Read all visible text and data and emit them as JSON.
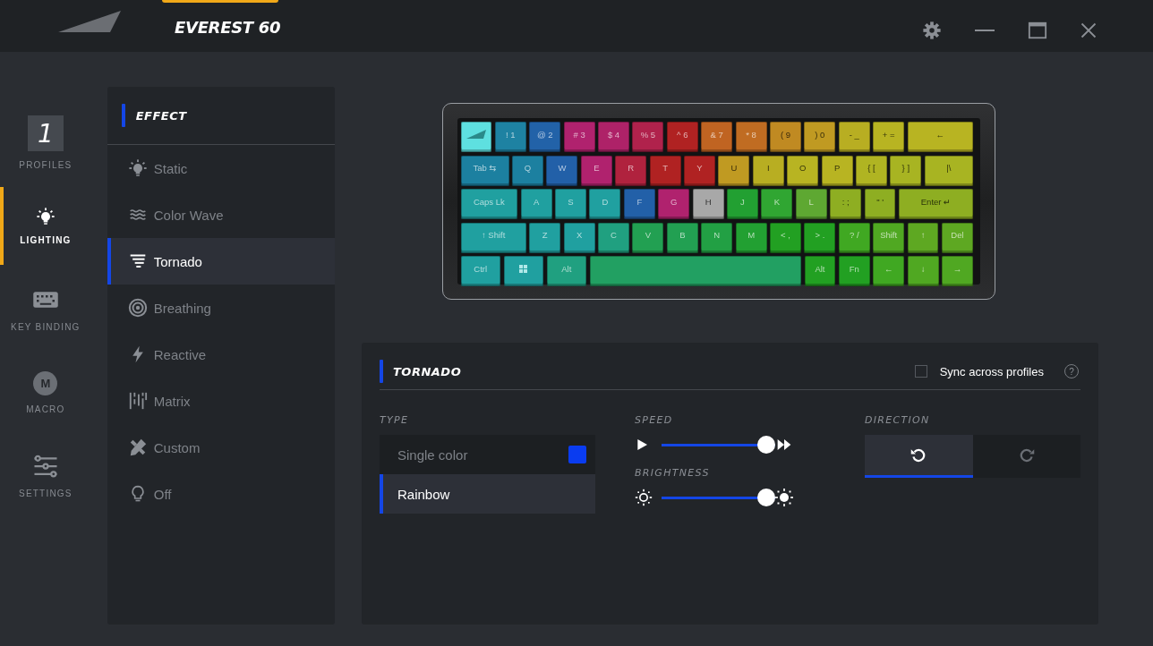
{
  "window": {
    "title": "EVEREST 60",
    "controls": [
      {
        "kind": "settings"
      },
      {
        "kind": "minimize"
      },
      {
        "kind": "maximize"
      },
      {
        "kind": "close"
      }
    ]
  },
  "nav": [
    {
      "kind": "profile",
      "badge": "1",
      "label": "PROFILES",
      "selected": false
    },
    {
      "kind": "lighting",
      "label": "LIGHTING",
      "selected": true
    },
    {
      "kind": "keys",
      "label": "KEY BINDING",
      "selected": false
    },
    {
      "kind": "macro",
      "badge": "M",
      "label": "MACRO",
      "selected": false
    },
    {
      "kind": "settings",
      "label": "SETTINGS",
      "selected": false
    }
  ],
  "effects": {
    "title": "EFFECT",
    "items": [
      {
        "kind": "static",
        "label": "Static",
        "selected": false
      },
      {
        "kind": "wave",
        "label": "Color Wave",
        "selected": false
      },
      {
        "kind": "tornado",
        "label": "Tornado",
        "selected": true
      },
      {
        "kind": "breathing",
        "label": "Breathing",
        "selected": false
      },
      {
        "kind": "reactive",
        "label": "Reactive",
        "selected": false
      },
      {
        "kind": "matrix",
        "label": "Matrix",
        "selected": false
      },
      {
        "kind": "custom",
        "label": "Custom",
        "selected": false
      },
      {
        "kind": "off",
        "label": "Off",
        "selected": false
      }
    ]
  },
  "keyboard": {
    "rows": [
      [
        {
          "kind": "logo",
          "color": "#5ee0e0"
        },
        {
          "kind": "text",
          "label": "! 1",
          "color": "#1e82a2"
        },
        {
          "kind": "text",
          "label": "@ 2",
          "color": "#2262a8"
        },
        {
          "kind": "text",
          "label": "# 3",
          "color": "#b0226e"
        },
        {
          "kind": "text",
          "label": "$ 4",
          "color": "#ae2268"
        },
        {
          "kind": "text",
          "label": "% 5",
          "color": "#b0224c"
        },
        {
          "kind": "text",
          "label": "^ 6",
          "color": "#b02222"
        },
        {
          "kind": "text",
          "label": "& 7",
          "color": "#c06422"
        },
        {
          "kind": "text",
          "label": "* 8",
          "color": "#c06c22"
        },
        {
          "kind": "text",
          "label": "( 9",
          "color": "#c08a22"
        },
        {
          "kind": "text",
          "label": ") 0",
          "color": "#c09a22"
        },
        {
          "kind": "text",
          "label": "- _",
          "color": "#b8ae22"
        },
        {
          "kind": "text",
          "label": "+ =",
          "color": "#b8b422"
        },
        {
          "kind": "text",
          "label": "←",
          "color": "#b8b422"
        }
      ],
      [
        {
          "kind": "text",
          "label": "Tab ⇆",
          "color": "#1c80a0"
        },
        {
          "kind": "text",
          "label": "Q",
          "color": "#1c80a0"
        },
        {
          "kind": "text",
          "label": "W",
          "color": "#2260a8"
        },
        {
          "kind": "text",
          "label": "E",
          "color": "#b0226e"
        },
        {
          "kind": "text",
          "label": "R",
          "color": "#b0223e"
        },
        {
          "kind": "text",
          "label": "T",
          "color": "#b02222"
        },
        {
          "kind": "text",
          "label": "Y",
          "color": "#b02222"
        },
        {
          "kind": "text",
          "label": "U",
          "color": "#c09a22"
        },
        {
          "kind": "text",
          "label": "I",
          "color": "#b8ae22"
        },
        {
          "kind": "text",
          "label": "O",
          "color": "#b8b422"
        },
        {
          "kind": "text",
          "label": "P",
          "color": "#b8b422"
        },
        {
          "kind": "text",
          "label": "{ [",
          "color": "#b0b422"
        },
        {
          "kind": "text",
          "label": "} ]",
          "color": "#a8b422"
        },
        {
          "kind": "text",
          "label": "|\\",
          "color": "#a8b422"
        }
      ],
      [
        {
          "kind": "text",
          "label": "Caps Lk",
          "color": "#20a0a0"
        },
        {
          "kind": "text",
          "label": "A",
          "color": "#20a0a0"
        },
        {
          "kind": "text",
          "label": "S",
          "color": "#20a0a0"
        },
        {
          "kind": "text",
          "label": "D",
          "color": "#20a0a0"
        },
        {
          "kind": "text",
          "label": "F",
          "color": "#2260a8"
        },
        {
          "kind": "text",
          "label": "G",
          "color": "#b0226e"
        },
        {
          "kind": "text",
          "label": "H",
          "color": "#a8a8a8"
        },
        {
          "kind": "text",
          "label": "J",
          "color": "#22a032"
        },
        {
          "kind": "text",
          "label": "K",
          "color": "#30a632"
        },
        {
          "kind": "text",
          "label": "L",
          "color": "#5ea832"
        },
        {
          "kind": "text",
          "label": ": ;",
          "color": "#8eae22"
        },
        {
          "kind": "text",
          "label": "\" '",
          "color": "#8eae22"
        },
        {
          "kind": "text",
          "label": "Enter ↵",
          "color": "#8eae22"
        }
      ],
      [
        {
          "kind": "text",
          "label": "↑ Shift",
          "color": "#20a0a0"
        },
        {
          "kind": "text",
          "label": "Z",
          "color": "#20a0a0"
        },
        {
          "kind": "text",
          "label": "X",
          "color": "#20a0a0"
        },
        {
          "kind": "text",
          "label": "C",
          "color": "#20a080"
        },
        {
          "kind": "text",
          "label": "V",
          "color": "#22a052"
        },
        {
          "kind": "text",
          "label": "B",
          "color": "#22a052"
        },
        {
          "kind": "text",
          "label": "N",
          "color": "#22a044"
        },
        {
          "kind": "text",
          "label": "M",
          "color": "#22a032"
        },
        {
          "kind": "text",
          "label": "< ,",
          "color": "#22a022"
        },
        {
          "kind": "text",
          "label": "> .",
          "color": "#22a022"
        },
        {
          "kind": "text",
          "label": "? /",
          "color": "#40a822"
        },
        {
          "kind": "text",
          "label": "Shift",
          "color": "#50a822"
        },
        {
          "kind": "text",
          "label": "↑",
          "color": "#5ea822"
        },
        {
          "kind": "text",
          "label": "Del",
          "color": "#5ea822"
        }
      ],
      [
        {
          "kind": "text",
          "label": "Ctrl",
          "color": "#20a0a0"
        },
        {
          "kind": "windows",
          "color": "#20a0a0"
        },
        {
          "kind": "text",
          "label": "Alt",
          "color": "#20a080"
        },
        {
          "kind": "blank",
          "color": "#22a062"
        },
        {
          "kind": "text",
          "label": "Alt",
          "color": "#22a022"
        },
        {
          "kind": "text",
          "label": "Fn",
          "color": "#22a022"
        },
        {
          "kind": "text",
          "label": "←",
          "color": "#40a822"
        },
        {
          "kind": "text",
          "label": "↓",
          "color": "#50a822"
        },
        {
          "kind": "text",
          "label": "→",
          "color": "#50a822"
        }
      ]
    ]
  },
  "settings": {
    "title": "TORNADO",
    "sync": {
      "label": "Sync across profiles",
      "checked": false
    },
    "help": "?",
    "type": {
      "label": "TYPE",
      "options": [
        {
          "label": "Single color",
          "selected": false,
          "color": "#0a3cf0"
        },
        {
          "label": "Rainbow",
          "selected": true
        }
      ]
    },
    "speed": {
      "label": "SPEED",
      "level": 1
    },
    "brightness": {
      "label": "BRIGHTNESS",
      "level": 1
    },
    "direction": {
      "label": "DIRECTION",
      "options": [
        {
          "kind": "counterclockwise",
          "selected": true
        },
        {
          "kind": "clockwise",
          "selected": false
        }
      ]
    }
  }
}
